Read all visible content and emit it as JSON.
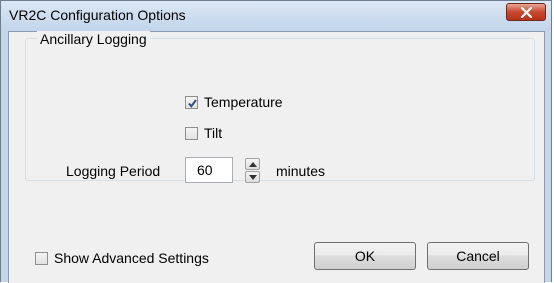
{
  "window": {
    "title": "VR2C Configuration Options"
  },
  "group": {
    "label": "Ancillary Logging",
    "temperature": {
      "label": "Temperature",
      "checked": true
    },
    "tilt": {
      "label": "Tilt",
      "checked": false
    },
    "logging_period": {
      "label": "Logging Period",
      "value": "60",
      "unit": "minutes"
    }
  },
  "footer": {
    "show_advanced": {
      "label": "Show Advanced Settings",
      "checked": false
    },
    "ok_label": "OK",
    "cancel_label": "Cancel"
  },
  "icons": {
    "close": "close-icon",
    "check": "checkmark-icon",
    "spin_up": "arrow-up-icon",
    "spin_down": "arrow-down-icon"
  },
  "colors": {
    "title_bar": "#c4d6ea",
    "close_button": "#c9472f",
    "dialog_background": "#f0f0f0"
  }
}
